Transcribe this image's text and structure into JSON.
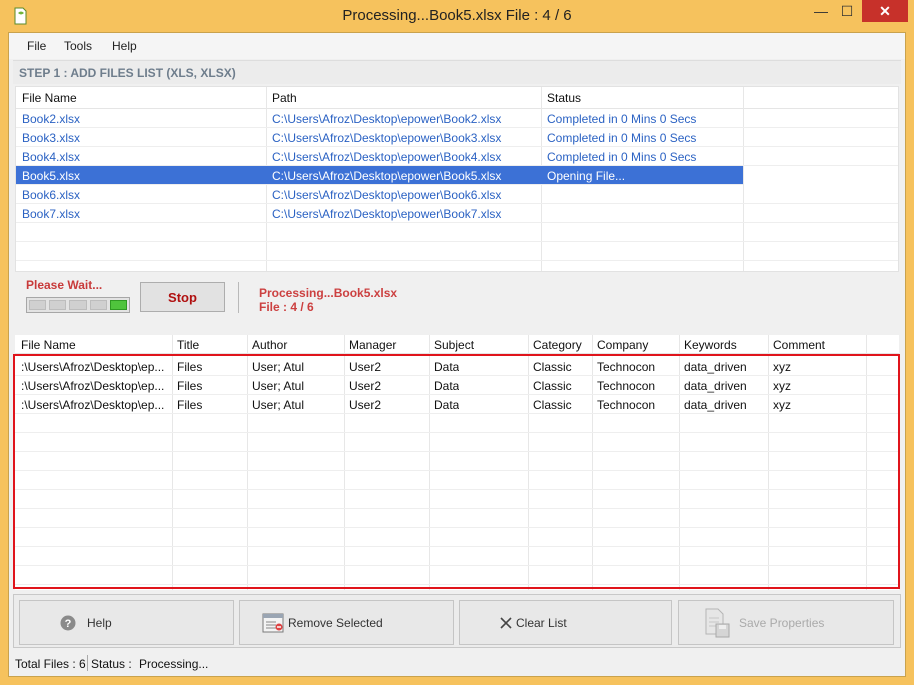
{
  "window": {
    "title": "Processing...Book5.xlsx File : 4 / 6",
    "min_glyph": "—",
    "max_glyph": "☐",
    "close_glyph": "✕"
  },
  "menu": [
    "File",
    "Tools",
    "Help"
  ],
  "step1": {
    "label": "STEP 1 : ADD FILES LIST (XLS, XLSX)"
  },
  "files_table": {
    "columns": [
      "File Name",
      "Path",
      "Status"
    ],
    "rows": [
      {
        "name": "Book2.xlsx",
        "path": "C:\\Users\\Afroz\\Desktop\\epower\\Book2.xlsx",
        "status": "Completed in 0 Mins 0 Secs"
      },
      {
        "name": "Book3.xlsx",
        "path": "C:\\Users\\Afroz\\Desktop\\epower\\Book3.xlsx",
        "status": "Completed in 0 Mins 0 Secs"
      },
      {
        "name": "Book4.xlsx",
        "path": "C:\\Users\\Afroz\\Desktop\\epower\\Book4.xlsx",
        "status": "Completed in 0 Mins 0 Secs"
      },
      {
        "name": "Book5.xlsx",
        "path": "C:\\Users\\Afroz\\Desktop\\epower\\Book5.xlsx",
        "status": "Opening File..."
      },
      {
        "name": "Book6.xlsx",
        "path": "C:\\Users\\Afroz\\Desktop\\epower\\Book6.xlsx",
        "status": ""
      },
      {
        "name": "Book7.xlsx",
        "path": "C:\\Users\\Afroz\\Desktop\\epower\\Book7.xlsx",
        "status": ""
      }
    ],
    "selected_index": 3
  },
  "progress": {
    "wait_label": "Please Wait...",
    "segments_total": 5,
    "segments_active": 1,
    "stop_label": "Stop",
    "processing_text": "Processing...Book5.xlsx",
    "file_count_text": "File : 4 / 6"
  },
  "properties_table": {
    "columns": [
      "File Name",
      "Title",
      "Author",
      "Manager",
      "Subject",
      "Category",
      "Company",
      "Keywords",
      "Comment"
    ],
    "rows": [
      [
        ":\\Users\\Afroz\\Desktop\\ep...",
        "Files",
        "User; Atul",
        "User2",
        "Data",
        "Classic",
        "Technocon",
        "data_driven",
        "xyz"
      ],
      [
        ":\\Users\\Afroz\\Desktop\\ep...",
        "Files",
        "User; Atul",
        "User2",
        "Data",
        "Classic",
        "Technocon",
        "data_driven",
        "xyz"
      ],
      [
        ":\\Users\\Afroz\\Desktop\\ep...",
        "Files",
        "User; Atul",
        "User2",
        "Data",
        "Classic",
        "Technocon",
        "data_driven",
        "xyz"
      ]
    ]
  },
  "buttons": {
    "help": "Help",
    "remove_selected": "Remove Selected",
    "clear_list": "Clear List",
    "save_properties": "Save Properties"
  },
  "statusbar": {
    "total_files": "Total Files : 6",
    "status_label": "Status :",
    "status_value": "Processing..."
  },
  "colors": {
    "title_bar": "#f6c25d",
    "close_button": "#c7312a",
    "link_blue": "#2b62c3",
    "selection": "#3c71d6",
    "wait_red": "#c83a3a",
    "highlight_frame": "#e0141b",
    "progress_green": "#4fc43c"
  },
  "icons": {
    "app": "document-leaf-icon",
    "help": "question-circle-icon",
    "remove": "list-remove-icon",
    "clear": "x-icon",
    "save": "save-document-icon"
  }
}
